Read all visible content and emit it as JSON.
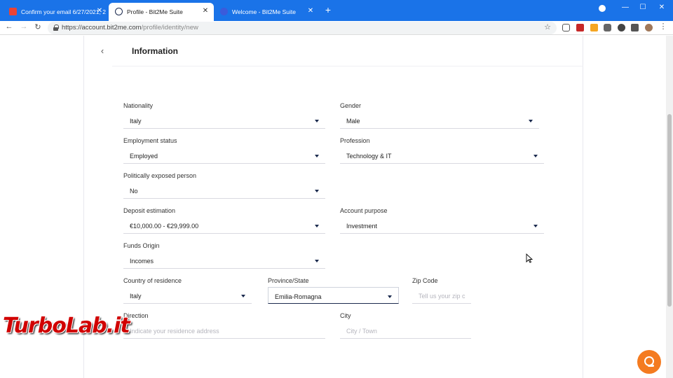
{
  "browser": {
    "tabs": [
      {
        "label": "Confirm your email 6/27/2021, 2"
      },
      {
        "label": "Profile - Bit2Me Suite"
      },
      {
        "label": "Welcome - Bit2Me Suite"
      }
    ],
    "url_host": "https://account.bit2me.com",
    "url_path": "/profile/identity/new"
  },
  "card": {
    "title": "Information"
  },
  "form": {
    "nationality": {
      "label": "Nationality",
      "value": "Italy"
    },
    "gender": {
      "label": "Gender",
      "value": "Male"
    },
    "employment_status": {
      "label": "Employment status",
      "value": "Employed"
    },
    "profession": {
      "label": "Profession",
      "value": "Technology & IT"
    },
    "politically_exposed": {
      "label": "Politically exposed person",
      "value": "No"
    },
    "deposit_estimation": {
      "label": "Deposit estimation",
      "value": "€10,000.00 - €29,999.00"
    },
    "account_purpose": {
      "label": "Account purpose",
      "value": "Investment"
    },
    "funds_origin": {
      "label": "Funds Origin",
      "value": "Incomes"
    },
    "country_of_residence": {
      "label": "Country of residence",
      "value": "Italy"
    },
    "province_state": {
      "label": "Province/State",
      "value": "Emilia-Romagna"
    },
    "zip_code": {
      "label": "Zip Code",
      "placeholder": "Tell us your zip c"
    },
    "direction": {
      "label": "Direction",
      "placeholder": "Indicate your residence address"
    },
    "city": {
      "label": "City",
      "placeholder": "City / Town"
    }
  },
  "watermark": "TurboLab.it",
  "colors": {
    "chrome_blue": "#1a73e8",
    "caret_navy": "#1b2a4e",
    "chat_orange": "#f47b20",
    "watermark_red": "#d10000"
  },
  "icons": [
    "back-arrow-icon",
    "forward-arrow-icon",
    "reload-icon",
    "lock-icon",
    "star-icon",
    "chat-support-icon",
    "chevron-down-icon"
  ]
}
